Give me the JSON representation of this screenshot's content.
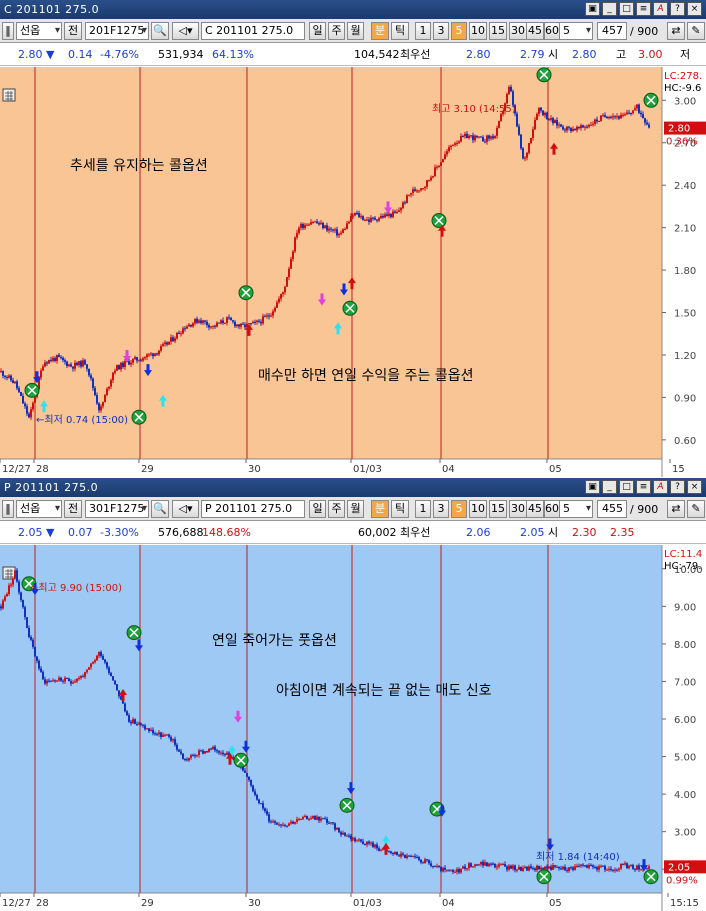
{
  "panels": [
    {
      "id": "call",
      "title": "C 201101 275.0",
      "toolbar": {
        "market": "선옵",
        "jeon": "전",
        "code": "201F1275",
        "name": "C 201101 275.0",
        "periods": [
          "일",
          "주",
          "월"
        ],
        "bun": "분",
        "tick": "틱",
        "intervals": [
          "1",
          "3",
          "5",
          "10",
          "15",
          "30",
          "45",
          "60"
        ],
        "active_interval": "5",
        "interval_select": "5",
        "count": "457",
        "max": "/ 900"
      },
      "info": {
        "price": "2.80",
        "arrow": "▼",
        "change": "0.14",
        "pct": "-4.76%",
        "volume": "531,934",
        "vol_ratio": "64.13%",
        "oi": "104,542",
        "best_label": "최우선",
        "bid": "2.80",
        "ask": "2.79",
        "open_label": "시",
        "open": "2.80",
        "high_label": "고",
        "high": "3.00",
        "low_label": "저"
      },
      "readouts": {
        "lc": "LC:278.",
        "hc": "HC:-9.6",
        "last_price": "2.80",
        "last_pct": "0.36%"
      },
      "annotations": {
        "text1": "추세를 유지하는 콜옵션",
        "text2": "매수만 하면 연일 수익을 주는 콜옵션",
        "high": "최고 3.10 (14:55)",
        "low": "←최저 0.74 (15:00)"
      },
      "x_labels": [
        "12/27",
        "28",
        "29",
        "30",
        "01/03",
        "04",
        "05",
        "15"
      ],
      "y_labels": [
        "3.00",
        "2.70",
        "2.40",
        "2.10",
        "1.80",
        "1.50",
        "1.20",
        "0.90",
        "0.60"
      ]
    },
    {
      "id": "put",
      "title": "P 201101 275.0",
      "toolbar": {
        "market": "선옵",
        "jeon": "전",
        "code": "301F1275",
        "name": "P 201101 275.0",
        "periods": [
          "일",
          "주",
          "월"
        ],
        "bun": "분",
        "tick": "틱",
        "intervals": [
          "1",
          "3",
          "5",
          "10",
          "15",
          "30",
          "45",
          "60"
        ],
        "active_interval": "5",
        "interval_select": "5",
        "count": "455",
        "max": "/ 900"
      },
      "info": {
        "price": "2.05",
        "arrow": "▼",
        "change": "0.07",
        "pct": "-3.30%",
        "volume": "576,688",
        "vol_ratio": "148.68%",
        "oi": "60,002",
        "best_label": "최우선",
        "bid": "2.06",
        "ask": "2.05",
        "open_label": "시",
        "open": "2.30",
        "high": "2.35"
      },
      "readouts": {
        "lc": "LC:11.4",
        "hc": "HC:-79.",
        "last_price": "2.05",
        "last_pct": "0.99%"
      },
      "annotations": {
        "text1": "연일 죽어가는 풋옵션",
        "text2": "아침이면 계속되는 끝 없는 매도 신호",
        "high": "←최고 9.90 (15:00)",
        "low": "최저 1.84 (14:40)"
      },
      "x_labels": [
        "12/27",
        "28",
        "29",
        "30",
        "01/03",
        "04",
        "05",
        "15:15"
      ],
      "y_labels": [
        "10.00",
        "9.00",
        "8.00",
        "7.00",
        "6.00",
        "5.00",
        "4.00",
        "3.00",
        "2.00"
      ]
    }
  ],
  "colors": {
    "call_bg": "#f9c595",
    "put_bg": "#9fc9f5",
    "candle_up": "#d01010",
    "candle_down": "#1030c0",
    "day_line": "#c02020",
    "signal_green": "#1fa23a",
    "arrow_blue": "#1030e0",
    "arrow_magenta": "#e040e0",
    "arrow_cyan": "#30e0f0"
  },
  "chart_data": [
    {
      "type": "line",
      "title": "",
      "series": [
        {
          "name": "",
          "x": [
            0,
            10,
            20,
            30,
            40,
            50,
            60,
            70,
            80,
            90,
            100,
            110,
            120,
            130,
            140,
            150,
            160,
            170,
            180,
            190,
            200,
            210,
            220,
            230,
            240,
            250,
            260,
            270,
            280,
            290,
            300,
            310,
            320,
            330,
            340,
            350,
            360,
            370,
            380,
            390,
            400,
            410,
            420,
            430,
            440,
            450,
            460
          ],
          "values": [
            1.08,
            1.0,
            0.75,
            1.15,
            1.18,
            1.12,
            1.15,
            0.8,
            1.1,
            1.15,
            1.18,
            1.22,
            1.3,
            1.4,
            1.45,
            1.4,
            1.45,
            1.4,
            1.42,
            1.48,
            1.65,
            2.1,
            2.15,
            2.1,
            2.05,
            2.2,
            2.15,
            2.18,
            2.2,
            2.35,
            2.4,
            2.55,
            2.7,
            2.75,
            2.72,
            2.75,
            3.1,
            2.55,
            2.95,
            2.85,
            2.8,
            2.8,
            2.85,
            2.9,
            2.88,
            2.95,
            2.8
          ]
        }
      ],
      "ylim": [
        0.5,
        3.2
      ],
      "xlabel": "",
      "ylabel": "",
      "annotations": [
        "최고 3.10 (14:55)",
        "최저 0.74 (15:00)"
      ]
    },
    {
      "type": "line",
      "title": "",
      "series": [
        {
          "name": "",
          "x": [
            0,
            10,
            20,
            30,
            40,
            50,
            60,
            70,
            80,
            90,
            100,
            110,
            120,
            130,
            140,
            150,
            160,
            170,
            180,
            190,
            200,
            210,
            220,
            230,
            240,
            250,
            260,
            270,
            280,
            290,
            300,
            310,
            320,
            330,
            340,
            350,
            360,
            370,
            380,
            390,
            400,
            410,
            420,
            430,
            440,
            450
          ],
          "values": [
            9.0,
            9.9,
            8.2,
            7.0,
            7.05,
            7.0,
            7.2,
            7.8,
            7.0,
            6.0,
            5.8,
            5.6,
            5.5,
            4.9,
            5.1,
            5.2,
            5.1,
            4.7,
            4.0,
            3.3,
            3.2,
            3.3,
            3.4,
            3.3,
            3.0,
            2.8,
            2.7,
            2.5,
            2.4,
            2.3,
            2.2,
            2.0,
            1.9,
            2.1,
            2.15,
            2.1,
            2.05,
            2.0,
            2.05,
            2.05,
            2.0,
            2.1,
            2.05,
            2.0,
            2.1,
            2.05
          ]
        }
      ],
      "ylim": [
        1.5,
        10.5
      ],
      "xlabel": "",
      "ylabel": "",
      "annotations": [
        "최고 9.90 (15:00)",
        "최저 1.84 (14:40)"
      ]
    }
  ]
}
